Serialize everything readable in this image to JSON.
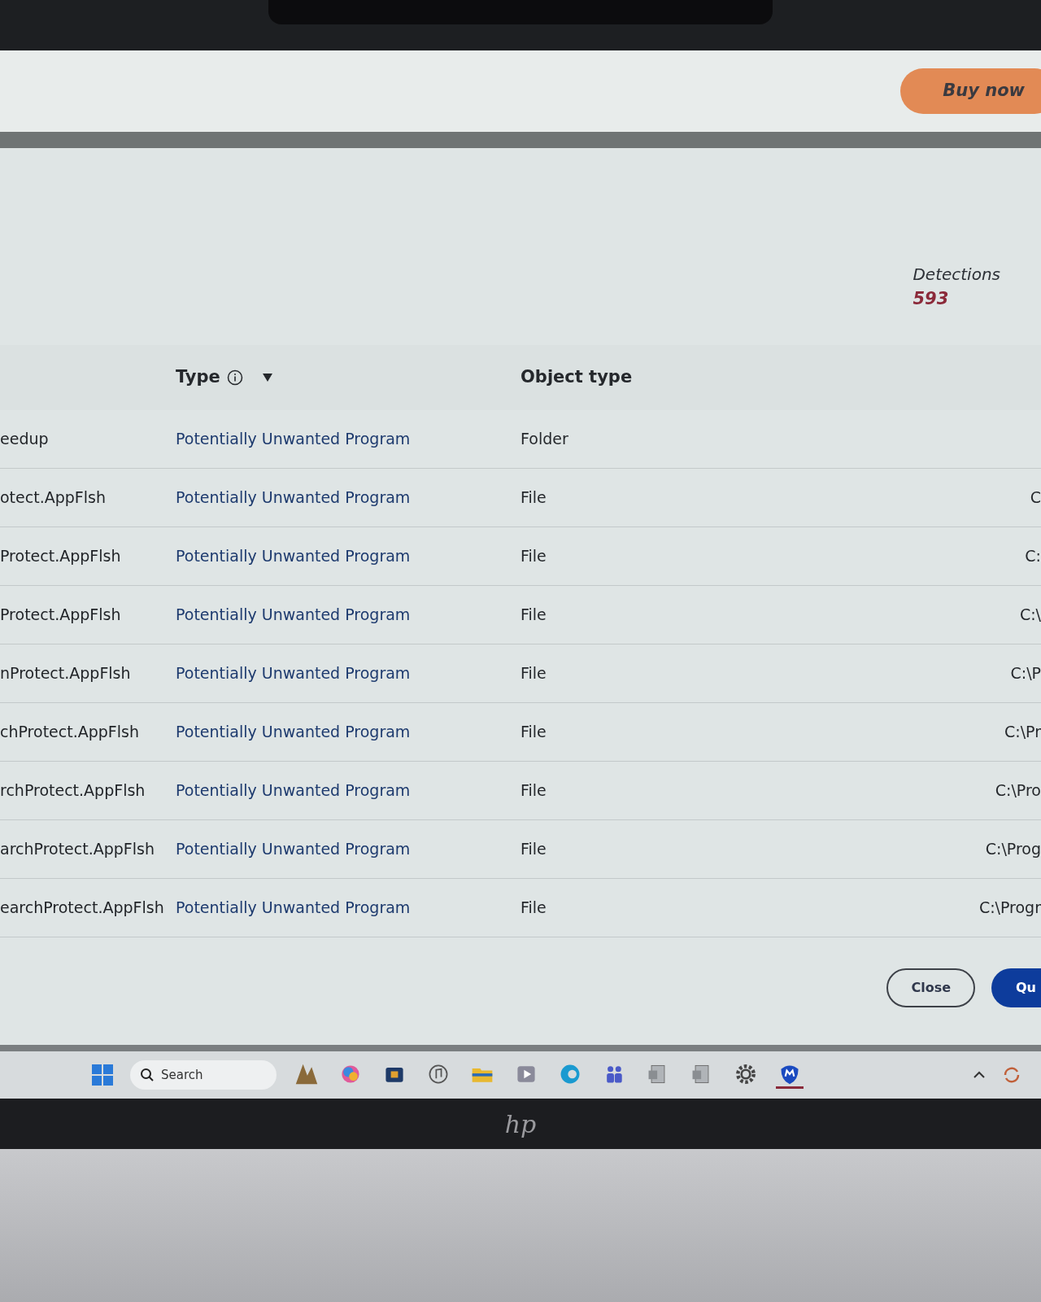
{
  "header": {
    "buy_button": "Buy now"
  },
  "summary": {
    "label": "Detections",
    "value": "593"
  },
  "table": {
    "columns": [
      {
        "label": "Type",
        "info": true,
        "sort_descending": true
      },
      {
        "label": "Object type"
      }
    ],
    "rows": [
      {
        "name": "eedup",
        "type": "Potentially Unwanted Program",
        "object_type": "Folder"
      },
      {
        "name": "otect.AppFlsh",
        "type": "Potentially Unwanted Program",
        "object_type": "File",
        "column_4": "C"
      },
      {
        "name": "Protect.AppFlsh",
        "type": "Potentially Unwanted Program",
        "object_type": "File",
        "column_4": "C:"
      },
      {
        "name": "Protect.AppFlsh",
        "type": "Potentially Unwanted Program",
        "object_type": "File",
        "column_4": "C:\\"
      },
      {
        "name": "nProtect.AppFlsh",
        "type": "Potentially Unwanted Program",
        "object_type": "File",
        "column_4": "C:\\P"
      },
      {
        "name": "chProtect.AppFlsh",
        "type": "Potentially Unwanted Program",
        "object_type": "File",
        "column_4": "C:\\Pr"
      },
      {
        "name": "rchProtect.AppFlsh",
        "type": "Potentially Unwanted Program",
        "object_type": "File",
        "column_4": "C:\\Pro"
      },
      {
        "name": "archProtect.AppFlsh",
        "type": "Potentially Unwanted Program",
        "object_type": "File",
        "column_4": "C:\\Prog"
      },
      {
        "name": "earchProtect.AppFlsh",
        "type": "Potentially Unwanted Program",
        "object_type": "File",
        "column_4": "C:\\Progr"
      }
    ]
  },
  "footer": {
    "buttons": [
      {
        "label": "Close",
        "kind": "outline"
      },
      {
        "label": "Qu",
        "kind": "primary"
      }
    ]
  },
  "taskbar": {
    "search_placeholder": "Search",
    "apps": [
      {
        "kind": "widget",
        "selected": false
      },
      {
        "kind": "swirl",
        "selected": false
      },
      {
        "kind": "store",
        "selected": false
      },
      {
        "kind": "music",
        "selected": false
      },
      {
        "kind": "folder",
        "selected": false
      },
      {
        "kind": "player",
        "selected": false
      },
      {
        "kind": "browser",
        "selected": false
      },
      {
        "kind": "people",
        "selected": false
      },
      {
        "kind": "doc",
        "selected": false
      },
      {
        "kind": "doc",
        "selected": false
      },
      {
        "kind": "gear",
        "selected": false
      },
      {
        "kind": "shield",
        "selected": true
      }
    ]
  },
  "bezel_logo": "hp"
}
